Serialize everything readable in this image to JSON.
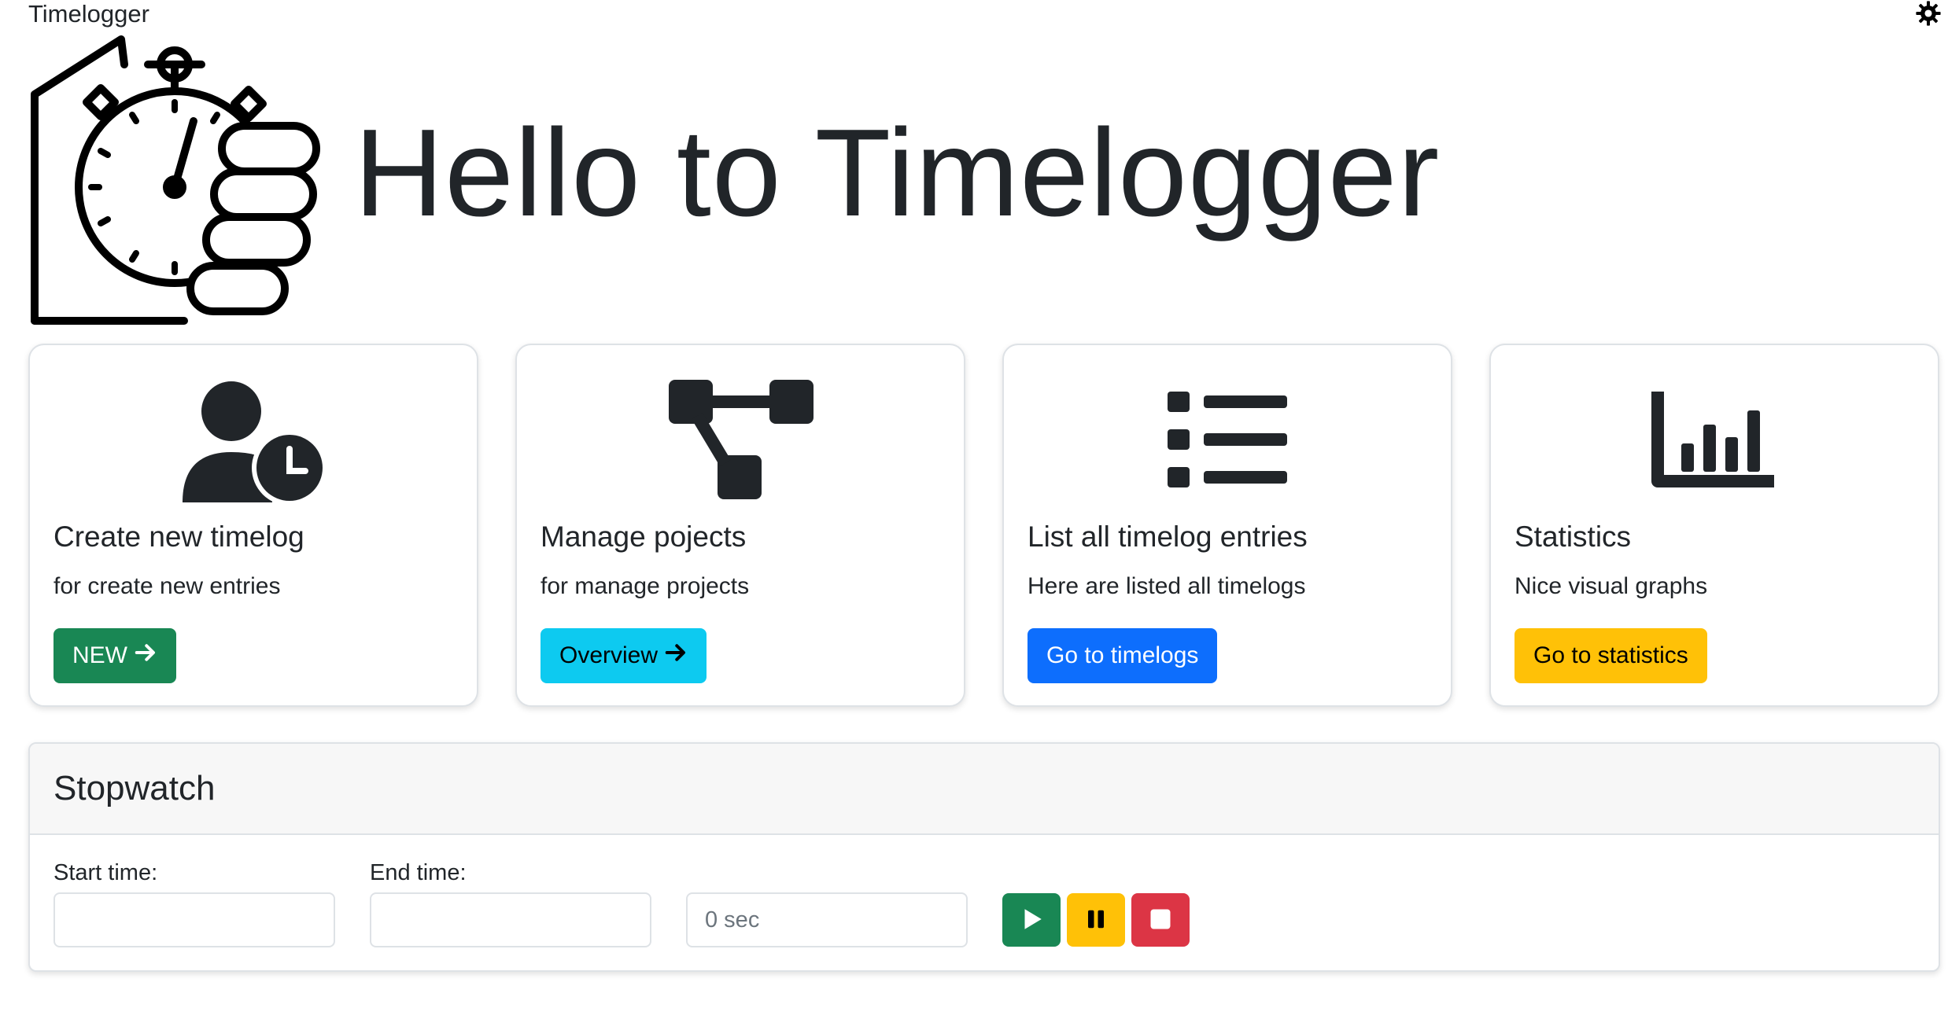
{
  "app": {
    "title": "Timelogger"
  },
  "hero": {
    "heading": "Hello to Timelogger"
  },
  "cards": [
    {
      "title": "Create new timelog",
      "subtitle": "for create new entries",
      "button": "NEW",
      "icon": "user-clock-icon",
      "button_color": "#198754"
    },
    {
      "title": "Manage pojects",
      "subtitle": "for manage projects",
      "button": "Overview",
      "icon": "sitemap-icon",
      "button_color": "#0dcaf0"
    },
    {
      "title": "List all timelog entries",
      "subtitle": "Here are listed all timelogs",
      "button": "Go to timelogs",
      "icon": "list-icon",
      "button_color": "#0d6efd"
    },
    {
      "title": "Statistics",
      "subtitle": "Nice visual graphs",
      "button": "Go to statistics",
      "icon": "bar-chart-icon",
      "button_color": "#ffc107"
    }
  ],
  "stopwatch": {
    "title": "Stopwatch",
    "start_label": "Start time:",
    "end_label": "End time:",
    "start_value": "",
    "end_value": "",
    "elapsed": "0 sec",
    "controls": [
      {
        "icon": "play-icon",
        "color": "#198754"
      },
      {
        "icon": "pause-icon",
        "color": "#ffc107"
      },
      {
        "icon": "stop-icon",
        "color": "#dc3545"
      }
    ]
  }
}
